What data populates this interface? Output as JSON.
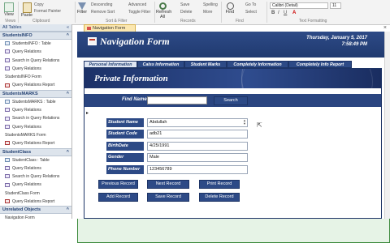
{
  "ribbon": {
    "view_label": "View",
    "views_group": "Views",
    "paste_label": "Paste",
    "copy_label": "Copy",
    "format_painter_label": "Format Painter",
    "clipboard_group": "Clipboard",
    "filter_label": "Filter",
    "descending_label": "Descending",
    "remove_sort_label": "Remove Sort",
    "advanced_label": "Advanced",
    "toggle_filter_label": "Toggle Filter",
    "sort_filter_group": "Sort & Filter",
    "refresh_label": "Refresh All",
    "save_label": "Save",
    "delete_label": "Delete",
    "more_label": "More",
    "spelling_label": "Spelling",
    "records_group": "Records",
    "find_label": "Find",
    "goto_label": "Go To",
    "select_label": "Select",
    "find_group": "Find",
    "text_formatting_group": "Text Formatting",
    "font_name": "Calibri (Detail)",
    "font_size": "11"
  },
  "nav": {
    "header": "All Tables",
    "sections": [
      {
        "title": "StudentsINFO",
        "items": [
          {
            "label": "StudentsINFO : Table",
            "type": "table"
          },
          {
            "label": "Query Relations",
            "type": "query"
          },
          {
            "label": "Search in Query Relations",
            "type": "query"
          },
          {
            "label": "Query Relations",
            "type": "query"
          },
          {
            "label": "StudentsINFO Form",
            "type": "form"
          },
          {
            "label": "Query Relations Report",
            "type": "report"
          }
        ]
      },
      {
        "title": "StudentsMARKS",
        "items": [
          {
            "label": "StudentsMARKS : Table",
            "type": "table"
          },
          {
            "label": "Query Relations",
            "type": "query"
          },
          {
            "label": "Search in Query Relations",
            "type": "query"
          },
          {
            "label": "Query Relations",
            "type": "query"
          },
          {
            "label": "StudentsMARKS Form",
            "type": "form"
          },
          {
            "label": "Query Relations Report",
            "type": "report"
          }
        ]
      },
      {
        "title": "StudentClass",
        "items": [
          {
            "label": "StudentClass : Table",
            "type": "table"
          },
          {
            "label": "Query Relations",
            "type": "query"
          },
          {
            "label": "Search in Query Relations",
            "type": "query"
          },
          {
            "label": "Query Relations",
            "type": "query"
          },
          {
            "label": "StudentClass Form",
            "type": "form"
          },
          {
            "label": "Query Relations Report",
            "type": "report"
          }
        ]
      },
      {
        "title": "Unrelated Objects",
        "items": [
          {
            "label": "Navigation Form",
            "type": "form"
          }
        ]
      }
    ]
  },
  "doc_tab": {
    "label": "Navigation Form"
  },
  "form": {
    "title": "Navigation Form",
    "date": "Thursday, January 5, 2017",
    "time": "7:58:49 PM",
    "tabs": [
      {
        "label": "Personal Information",
        "active": true
      },
      {
        "label": "Calss Information",
        "active": false
      },
      {
        "label": "Student Marks",
        "active": false
      },
      {
        "label": "Completely Information",
        "active": false
      },
      {
        "label": "Completely Info Report",
        "active": false
      }
    ],
    "section_title": "Private Information",
    "find_label": "Find Name:",
    "find_value": "",
    "search_button": "Search",
    "fields": [
      {
        "label": "Student Name",
        "value": "Abdullah"
      },
      {
        "label": "Student Code",
        "value": "adb21"
      },
      {
        "label": "BirthDate",
        "value": "4/25/1991"
      },
      {
        "label": "Gender",
        "value": "Male"
      },
      {
        "label": "Phone Number",
        "value": "123456789"
      }
    ],
    "buttons": {
      "previous": "Previous Record",
      "next": "Next Record",
      "print": "Print Record",
      "add": "Add Record",
      "save": "Save Record",
      "delete": "Delete Record"
    }
  }
}
